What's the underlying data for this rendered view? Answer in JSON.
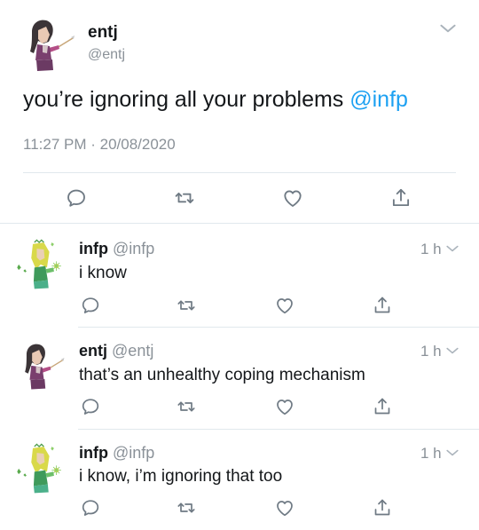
{
  "main_tweet": {
    "name": "entj",
    "handle": "@entj",
    "text": "you’re ignoring all your problems ",
    "mention": "@infp",
    "timestamp": "11:27 PM · 20/08/2020",
    "actions": [
      "reply-icon",
      "retweet-icon",
      "like-icon",
      "share-icon"
    ]
  },
  "replies": [
    {
      "name": "infp",
      "handle": "@infp",
      "time": "1 h",
      "text": "i know",
      "avatar": "infp-avatar"
    },
    {
      "name": "entj",
      "handle": "@entj",
      "time": "1 h",
      "text": "that’s an unhealthy coping mechanism",
      "avatar": "entj-avatar"
    },
    {
      "name": "infp",
      "handle": "@infp",
      "time": "1 h",
      "text": "i know, i’m ignoring that too",
      "avatar": "infp-avatar"
    }
  ],
  "colors": {
    "link": "#1da1f2",
    "muted": "#8a9198",
    "divider": "#e1e8ed"
  }
}
